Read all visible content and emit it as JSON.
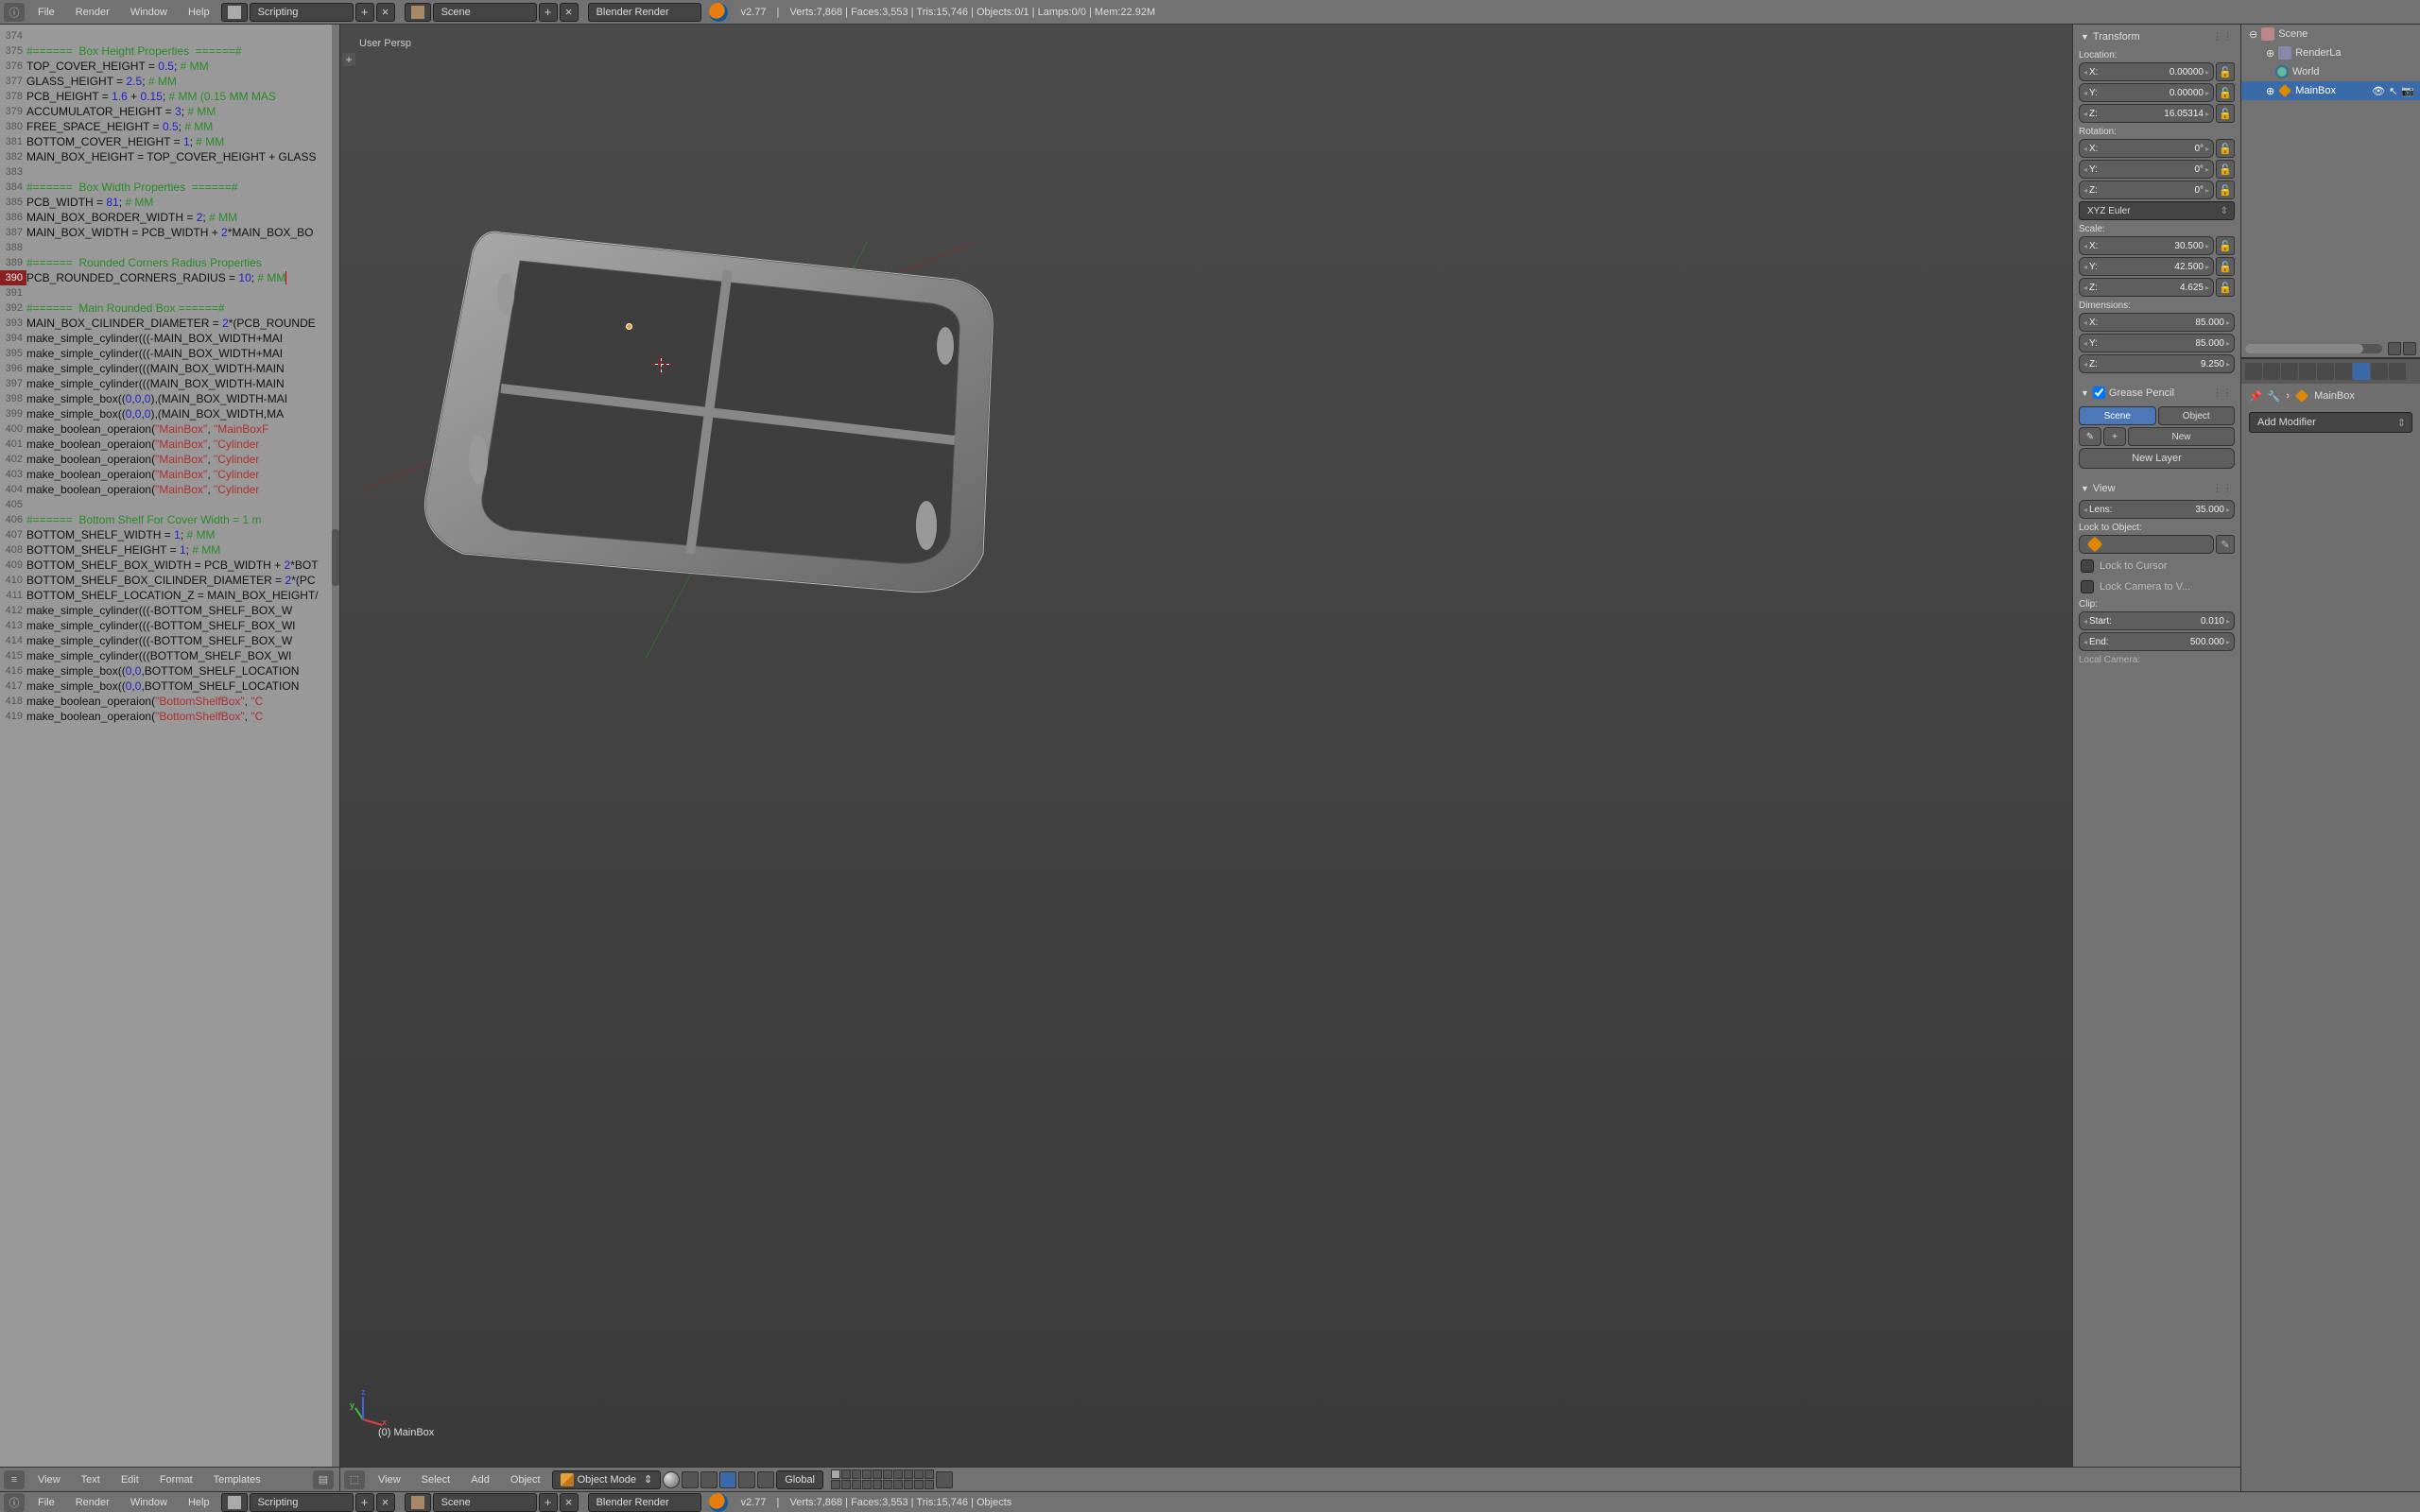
{
  "topbar": {
    "menus": [
      "File",
      "Render",
      "Window",
      "Help"
    ],
    "layout": "Scripting",
    "scene": "Scene",
    "engine": "Blender Render",
    "version": "v2.77",
    "stats": "Verts:7,868 | Faces:3,553 | Tris:15,746 | Objects:0/1 | Lamps:0/0 | Mem:22.92M"
  },
  "bottombar": {
    "stats": "Verts:7,868 | Faces:3,553 | Tris:15,746 | Objects"
  },
  "code": {
    "lines": [
      {
        "n": 374,
        "t": ""
      },
      {
        "n": 375,
        "t": "#======  Box Height Properties  ======#",
        "cls": "comment"
      },
      {
        "n": 376,
        "parts": [
          {
            "t": "TOP_COVER_HEIGHT = "
          },
          {
            "t": "0.5",
            "cls": "num"
          },
          {
            "t": "; "
          },
          {
            "t": "# MM",
            "cls": "comment"
          }
        ]
      },
      {
        "n": 377,
        "parts": [
          {
            "t": "GLASS_HEIGHT = "
          },
          {
            "t": "2.5",
            "cls": "num"
          },
          {
            "t": "; "
          },
          {
            "t": "# MM",
            "cls": "comment"
          }
        ]
      },
      {
        "n": 378,
        "parts": [
          {
            "t": "PCB_HEIGHT = "
          },
          {
            "t": "1.6",
            "cls": "num"
          },
          {
            "t": " + "
          },
          {
            "t": "0.15",
            "cls": "num"
          },
          {
            "t": "; "
          },
          {
            "t": "# MM (0.15 MM MAS",
            "cls": "comment"
          }
        ]
      },
      {
        "n": 379,
        "parts": [
          {
            "t": "ACCUMULATOR_HEIGHT = "
          },
          {
            "t": "3",
            "cls": "num"
          },
          {
            "t": "; "
          },
          {
            "t": "# MM",
            "cls": "comment"
          }
        ]
      },
      {
        "n": 380,
        "parts": [
          {
            "t": "FREE_SPACE_HEIGHT = "
          },
          {
            "t": "0.5",
            "cls": "num"
          },
          {
            "t": "; "
          },
          {
            "t": "# MM",
            "cls": "comment"
          }
        ]
      },
      {
        "n": 381,
        "parts": [
          {
            "t": "BOTTOM_COVER_HEIGHT = "
          },
          {
            "t": "1",
            "cls": "num"
          },
          {
            "t": "; "
          },
          {
            "t": "# MM",
            "cls": "comment"
          }
        ]
      },
      {
        "n": 382,
        "t": "MAIN_BOX_HEIGHT = TOP_COVER_HEIGHT + GLASS"
      },
      {
        "n": 383,
        "t": ""
      },
      {
        "n": 384,
        "t": "#======  Box Width Properties  ======#",
        "cls": "comment"
      },
      {
        "n": 385,
        "parts": [
          {
            "t": "PCB_WIDTH = "
          },
          {
            "t": "81",
            "cls": "num"
          },
          {
            "t": "; "
          },
          {
            "t": "# MM",
            "cls": "comment"
          }
        ]
      },
      {
        "n": 386,
        "parts": [
          {
            "t": "MAIN_BOX_BORDER_WIDTH = "
          },
          {
            "t": "2",
            "cls": "num"
          },
          {
            "t": "; "
          },
          {
            "t": "# MM",
            "cls": "comment"
          }
        ]
      },
      {
        "n": 387,
        "parts": [
          {
            "t": "MAIN_BOX_WIDTH = PCB_WIDTH + "
          },
          {
            "t": "2",
            "cls": "num"
          },
          {
            "t": "*MAIN_BOX_BO"
          }
        ]
      },
      {
        "n": 388,
        "t": ""
      },
      {
        "n": 389,
        "t": "#======  Rounded Corners Radius Properties",
        "cls": "comment"
      },
      {
        "n": 390,
        "hl": true,
        "parts": [
          {
            "t": "PCB_ROUNDED_CORNERS_RADIUS = "
          },
          {
            "t": "10",
            "cls": "num"
          },
          {
            "t": "; "
          },
          {
            "t": "# MM",
            "cls": "comment",
            "cursor": true
          }
        ]
      },
      {
        "n": 391,
        "t": ""
      },
      {
        "n": 392,
        "t": "#======  Main Rounded Box ======#",
        "cls": "comment"
      },
      {
        "n": 393,
        "parts": [
          {
            "t": "MAIN_BOX_CILINDER_DIAMETER = "
          },
          {
            "t": "2",
            "cls": "num"
          },
          {
            "t": "*(PCB_ROUNDE"
          }
        ]
      },
      {
        "n": 394,
        "t": "make_simple_cylinder(((-MAIN_BOX_WIDTH+MAI"
      },
      {
        "n": 395,
        "t": "make_simple_cylinder(((-MAIN_BOX_WIDTH+MAI"
      },
      {
        "n": 396,
        "t": "make_simple_cylinder(((MAIN_BOX_WIDTH-MAIN"
      },
      {
        "n": 397,
        "t": "make_simple_cylinder(((MAIN_BOX_WIDTH-MAIN"
      },
      {
        "n": 398,
        "parts": [
          {
            "t": "make_simple_box(("
          },
          {
            "t": "0",
            "cls": "num"
          },
          {
            "t": ","
          },
          {
            "t": "0",
            "cls": "num"
          },
          {
            "t": ","
          },
          {
            "t": "0",
            "cls": "num"
          },
          {
            "t": "),(MAIN_BOX_WIDTH-MAI"
          }
        ]
      },
      {
        "n": 399,
        "parts": [
          {
            "t": "make_simple_box(("
          },
          {
            "t": "0",
            "cls": "num"
          },
          {
            "t": ","
          },
          {
            "t": "0",
            "cls": "num"
          },
          {
            "t": ","
          },
          {
            "t": "0",
            "cls": "num"
          },
          {
            "t": "),(MAIN_BOX_WIDTH,MA"
          }
        ]
      },
      {
        "n": 400,
        "parts": [
          {
            "t": "make_boolean_operaion("
          },
          {
            "t": "\"MainBox\"",
            "cls": "str"
          },
          {
            "t": ", "
          },
          {
            "t": "\"MainBoxF",
            "cls": "str"
          }
        ]
      },
      {
        "n": 401,
        "parts": [
          {
            "t": "make_boolean_operaion("
          },
          {
            "t": "\"MainBox\"",
            "cls": "str"
          },
          {
            "t": ", "
          },
          {
            "t": "\"Cylinder",
            "cls": "str"
          }
        ]
      },
      {
        "n": 402,
        "parts": [
          {
            "t": "make_boolean_operaion("
          },
          {
            "t": "\"MainBox\"",
            "cls": "str"
          },
          {
            "t": ", "
          },
          {
            "t": "\"Cylinder",
            "cls": "str"
          }
        ]
      },
      {
        "n": 403,
        "parts": [
          {
            "t": "make_boolean_operaion("
          },
          {
            "t": "\"MainBox\"",
            "cls": "str"
          },
          {
            "t": ", "
          },
          {
            "t": "\"Cylinder",
            "cls": "str"
          }
        ]
      },
      {
        "n": 404,
        "parts": [
          {
            "t": "make_boolean_operaion("
          },
          {
            "t": "\"MainBox\"",
            "cls": "str"
          },
          {
            "t": ", "
          },
          {
            "t": "\"Cylinder",
            "cls": "str"
          }
        ]
      },
      {
        "n": 405,
        "t": ""
      },
      {
        "n": 406,
        "t": "#======  Bottom Shelf For Cover Width = 1 m",
        "cls": "comment"
      },
      {
        "n": 407,
        "parts": [
          {
            "t": "BOTTOM_SHELF_WIDTH = "
          },
          {
            "t": "1",
            "cls": "num"
          },
          {
            "t": "; "
          },
          {
            "t": "# MM",
            "cls": "comment"
          }
        ]
      },
      {
        "n": 408,
        "parts": [
          {
            "t": "BOTTOM_SHELF_HEIGHT = "
          },
          {
            "t": "1",
            "cls": "num"
          },
          {
            "t": "; "
          },
          {
            "t": "# MM",
            "cls": "comment"
          }
        ]
      },
      {
        "n": 409,
        "parts": [
          {
            "t": "BOTTOM_SHELF_BOX_WIDTH = PCB_WIDTH + "
          },
          {
            "t": "2",
            "cls": "num"
          },
          {
            "t": "*BOT"
          }
        ]
      },
      {
        "n": 410,
        "parts": [
          {
            "t": "BOTTOM_SHELF_BOX_CILINDER_DIAMETER = "
          },
          {
            "t": "2",
            "cls": "num"
          },
          {
            "t": "*(PC"
          }
        ]
      },
      {
        "n": 411,
        "t": "BOTTOM_SHELF_LOCATION_Z = MAIN_BOX_HEIGHT/"
      },
      {
        "n": 412,
        "t": "make_simple_cylinder(((-BOTTOM_SHELF_BOX_W"
      },
      {
        "n": 413,
        "t": "make_simple_cylinder(((-BOTTOM_SHELF_BOX_WI"
      },
      {
        "n": 414,
        "t": "make_simple_cylinder(((-BOTTOM_SHELF_BOX_W"
      },
      {
        "n": 415,
        "t": "make_simple_cylinder(((BOTTOM_SHELF_BOX_WI"
      },
      {
        "n": 416,
        "parts": [
          {
            "t": "make_simple_box(("
          },
          {
            "t": "0",
            "cls": "num"
          },
          {
            "t": ","
          },
          {
            "t": "0",
            "cls": "num"
          },
          {
            "t": ",BOTTOM_SHELF_LOCATION"
          }
        ]
      },
      {
        "n": 417,
        "parts": [
          {
            "t": "make_simple_box(("
          },
          {
            "t": "0",
            "cls": "num"
          },
          {
            "t": ","
          },
          {
            "t": "0",
            "cls": "num"
          },
          {
            "t": ",BOTTOM_SHELF_LOCATION"
          }
        ]
      },
      {
        "n": 418,
        "parts": [
          {
            "t": "make_boolean_operaion("
          },
          {
            "t": "\"BottomShelfBox\"",
            "cls": "str"
          },
          {
            "t": ", "
          },
          {
            "t": "\"C",
            "cls": "str"
          }
        ]
      },
      {
        "n": 419,
        "parts": [
          {
            "t": "make_boolean_operaion("
          },
          {
            "t": "\"BottomShelfBox\"",
            "cls": "str"
          },
          {
            "t": ", "
          },
          {
            "t": "\"C",
            "cls": "str"
          }
        ]
      }
    ]
  },
  "text_footer": {
    "menus": [
      "View",
      "Text",
      "Edit",
      "Format",
      "Templates"
    ]
  },
  "viewport": {
    "perspLabel": "User Persp",
    "objectLabel": "(0) MainBox",
    "footerMenus": [
      "View",
      "Select",
      "Add",
      "Object"
    ],
    "mode": "Object Mode",
    "orient": "Global"
  },
  "transform": {
    "header": "Transform",
    "locLabel": "Location:",
    "loc": {
      "x": "0.00000",
      "y": "0.00000",
      "z": "16.05314"
    },
    "rotLabel": "Rotation:",
    "rot": {
      "x": "0°",
      "y": "0°",
      "z": "0°"
    },
    "rotMode": "XYZ Euler",
    "scaleLabel": "Scale:",
    "scale": {
      "x": "30.500",
      "y": "42.500",
      "z": "4.625"
    },
    "dimLabel": "Dimensions:",
    "dim": {
      "x": "85.000",
      "y": "85.000",
      "z": "9.250"
    }
  },
  "grease": {
    "header": "Grease Pencil",
    "scene": "Scene",
    "object": "Object",
    "new": "New",
    "newLayer": "New Layer"
  },
  "view": {
    "header": "View",
    "lens": "Lens:",
    "lensVal": "35.000",
    "lockObj": "Lock to Object:",
    "lockCursor": "Lock to Cursor",
    "lockCam": "Lock Camera to V...",
    "clip": "Clip:",
    "start": "Start:",
    "startVal": "0.010",
    "end": "End:",
    "endVal": "500.000",
    "localCam": "Local Camera:"
  },
  "outliner": {
    "scene": "Scene",
    "renderLa": "RenderLa",
    "world": "World",
    "mainbox": "MainBox"
  },
  "modifier": {
    "objName": "MainBox",
    "addModifier": "Add Modifier"
  }
}
